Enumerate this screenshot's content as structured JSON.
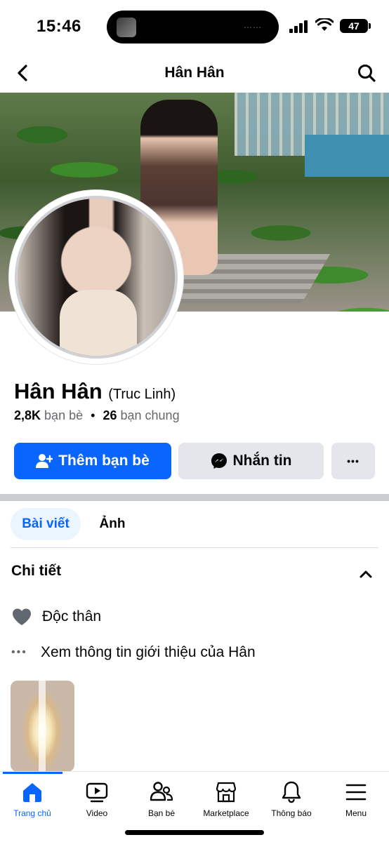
{
  "status_bar": {
    "time": "15:46",
    "battery": "47"
  },
  "header": {
    "title": "Hân Hân"
  },
  "profile": {
    "name": "Hân Hân",
    "alternate_name": "(Truc Linh)",
    "friends_count": "2,8K",
    "friends_label": "bạn bè",
    "separator": "•",
    "mutual_count": "26",
    "mutual_label": "bạn chung"
  },
  "actions": {
    "add_friend": "Thêm bạn bè",
    "message": "Nhắn tin",
    "more": "•••"
  },
  "tabs": [
    {
      "label": "Bài viết",
      "active": true
    },
    {
      "label": "Ảnh",
      "active": false
    }
  ],
  "details": {
    "title": "Chi tiết",
    "relationship": "Độc thân",
    "see_about": "Xem thông tin giới thiệu của Hân"
  },
  "bottom_nav": [
    {
      "label": "Trang chủ",
      "icon": "home-icon",
      "active": true
    },
    {
      "label": "Video",
      "icon": "video-icon",
      "active": false
    },
    {
      "label": "Bạn bè",
      "icon": "friends-icon",
      "active": false
    },
    {
      "label": "Marketplace",
      "icon": "marketplace-icon",
      "active": false
    },
    {
      "label": "Thông báo",
      "icon": "bell-icon",
      "active": false
    },
    {
      "label": "Menu",
      "icon": "menu-icon",
      "active": false
    }
  ],
  "colors": {
    "accent": "#0866ff",
    "button_gray": "#e4e6eb",
    "secondary_text": "#65676b"
  }
}
